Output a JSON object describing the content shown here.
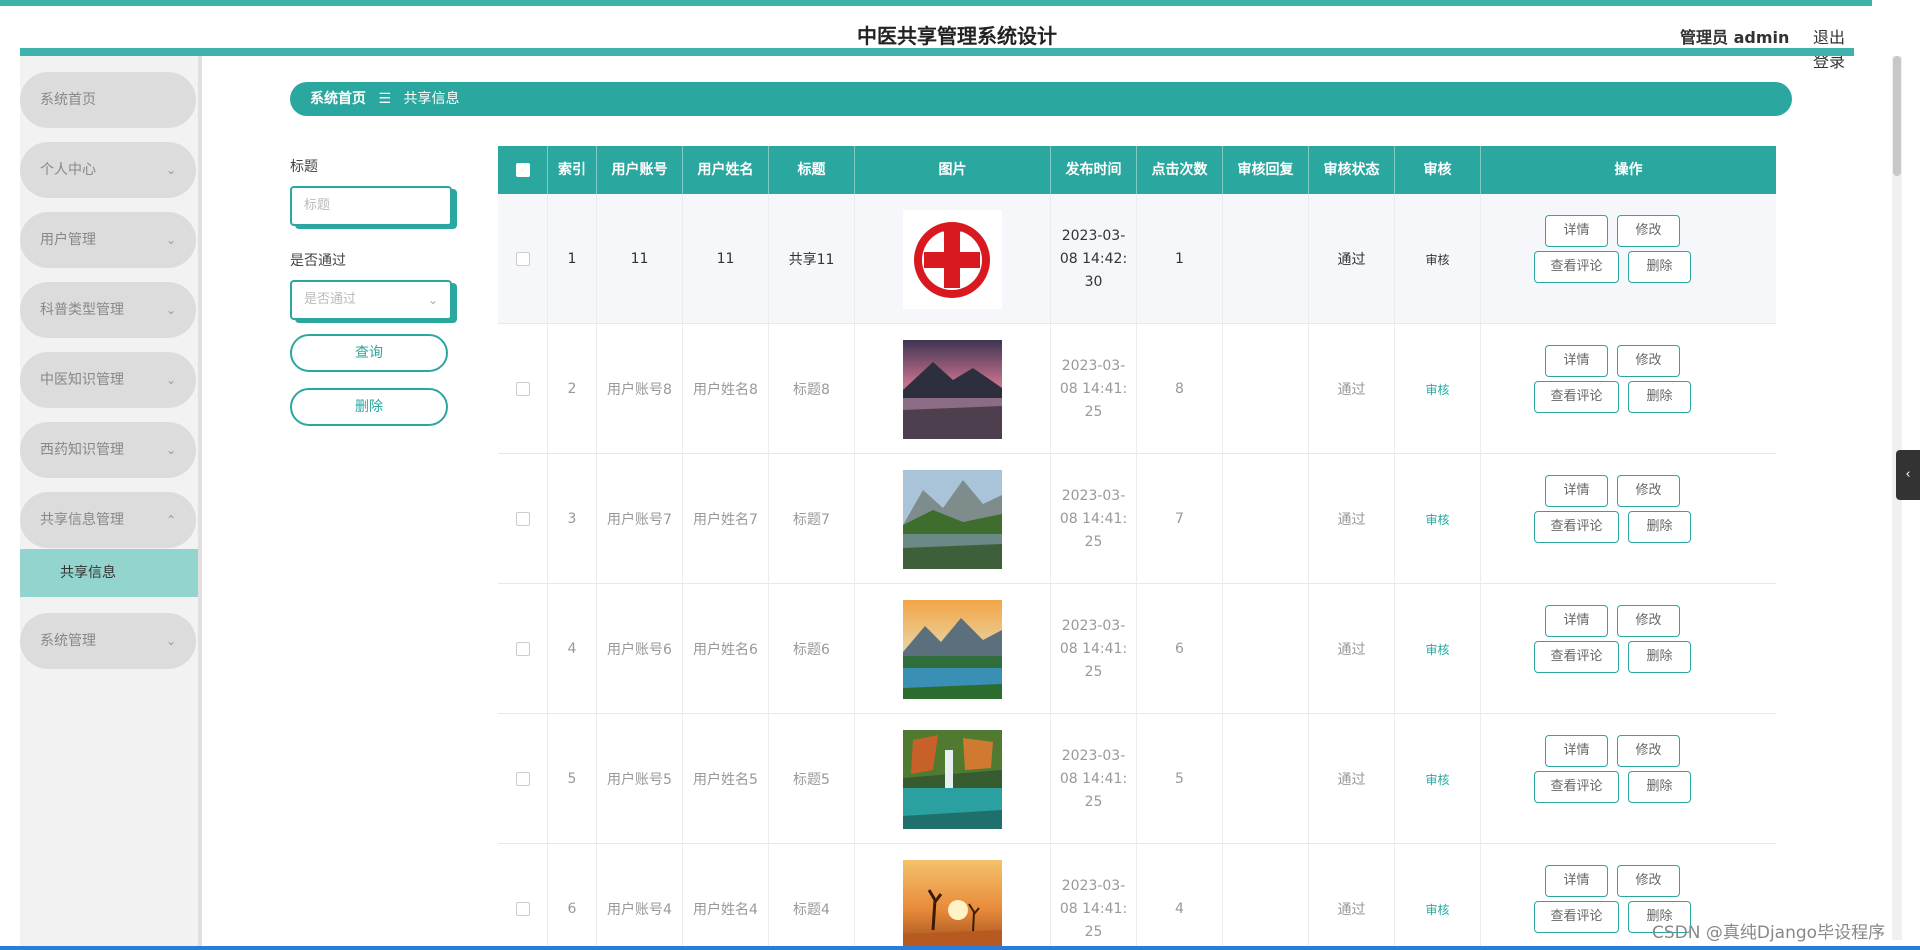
{
  "app": {
    "title": "中医共享管理系统设计",
    "admin_label": "管理员 admin",
    "logout_label": "退出登录"
  },
  "sidebar": {
    "items": [
      {
        "label": "系统首页",
        "has_chevron": false
      },
      {
        "label": "个人中心",
        "has_chevron": true
      },
      {
        "label": "用户管理",
        "has_chevron": true
      },
      {
        "label": "科普类型管理",
        "has_chevron": true
      },
      {
        "label": "中医知识管理",
        "has_chevron": true
      },
      {
        "label": "西药知识管理",
        "has_chevron": true
      },
      {
        "label": "共享信息管理",
        "has_chevron": true,
        "expanded": true
      },
      {
        "label": "系统管理",
        "has_chevron": true
      }
    ],
    "active_sub": "共享信息",
    "chevron_down": "⌄",
    "chevron_up": "⌃"
  },
  "breadcrumb": {
    "home": "系统首页",
    "separator": "☰",
    "current": "共享信息"
  },
  "filters": {
    "title_label": "标题",
    "title_placeholder": "标题",
    "pass_label": "是否通过",
    "pass_placeholder": "是否通过",
    "query_button": "查询",
    "delete_button": "删除"
  },
  "table": {
    "columns": [
      "索引",
      "用户账号",
      "用户姓名",
      "标题",
      "图片",
      "发布时间",
      "点击次数",
      "审核回复",
      "审核状态",
      "审核",
      "操作"
    ],
    "rows": [
      {
        "index": "1",
        "account": "11",
        "name": "11",
        "title": "共享11",
        "image": "red-cross",
        "time": [
          "2023-03-",
          "08 14:42:",
          "30"
        ],
        "clicks": "1",
        "reply": "",
        "status": "通过",
        "audit": "审核"
      },
      {
        "index": "2",
        "account": "用户账号8",
        "name": "用户姓名8",
        "title": "标题8",
        "image": "mountain-lake-pink",
        "time": [
          "2023-03-",
          "08 14:41:",
          "25"
        ],
        "clicks": "8",
        "reply": "",
        "status": "通过",
        "audit": "审核"
      },
      {
        "index": "3",
        "account": "用户账号7",
        "name": "用户姓名7",
        "title": "标题7",
        "image": "mountain-lake-green",
        "time": [
          "2023-03-",
          "08 14:41:",
          "25"
        ],
        "clicks": "7",
        "reply": "",
        "status": "通过",
        "audit": "审核"
      },
      {
        "index": "4",
        "account": "用户账号6",
        "name": "用户姓名6",
        "title": "标题6",
        "image": "sunset-mountain-lake",
        "time": [
          "2023-03-",
          "08 14:41:",
          "25"
        ],
        "clicks": "6",
        "reply": "",
        "status": "通过",
        "audit": "审核"
      },
      {
        "index": "5",
        "account": "用户账号5",
        "name": "用户姓名5",
        "title": "标题5",
        "image": "waterfall-forest",
        "time": [
          "2023-03-",
          "08 14:41:",
          "25"
        ],
        "clicks": "5",
        "reply": "",
        "status": "通过",
        "audit": "审核"
      },
      {
        "index": "6",
        "account": "用户账号4",
        "name": "用户姓名4",
        "title": "标题4",
        "image": "desert-tree",
        "time": [
          "2023-03-",
          "08 14:41:",
          "25"
        ],
        "clicks": "4",
        "reply": "",
        "status": "通过",
        "audit": "审核"
      }
    ],
    "actions": {
      "detail": "详情",
      "edit": "修改",
      "comments": "查看评论",
      "delete": "删除"
    }
  },
  "watermark": "CSDN @真纯Django毕设程序",
  "side_tab_icon": "‹",
  "colors": {
    "accent": "#2aa79f",
    "accent_light": "#93d4cf",
    "sidebar_item": "#dcdcdc"
  }
}
